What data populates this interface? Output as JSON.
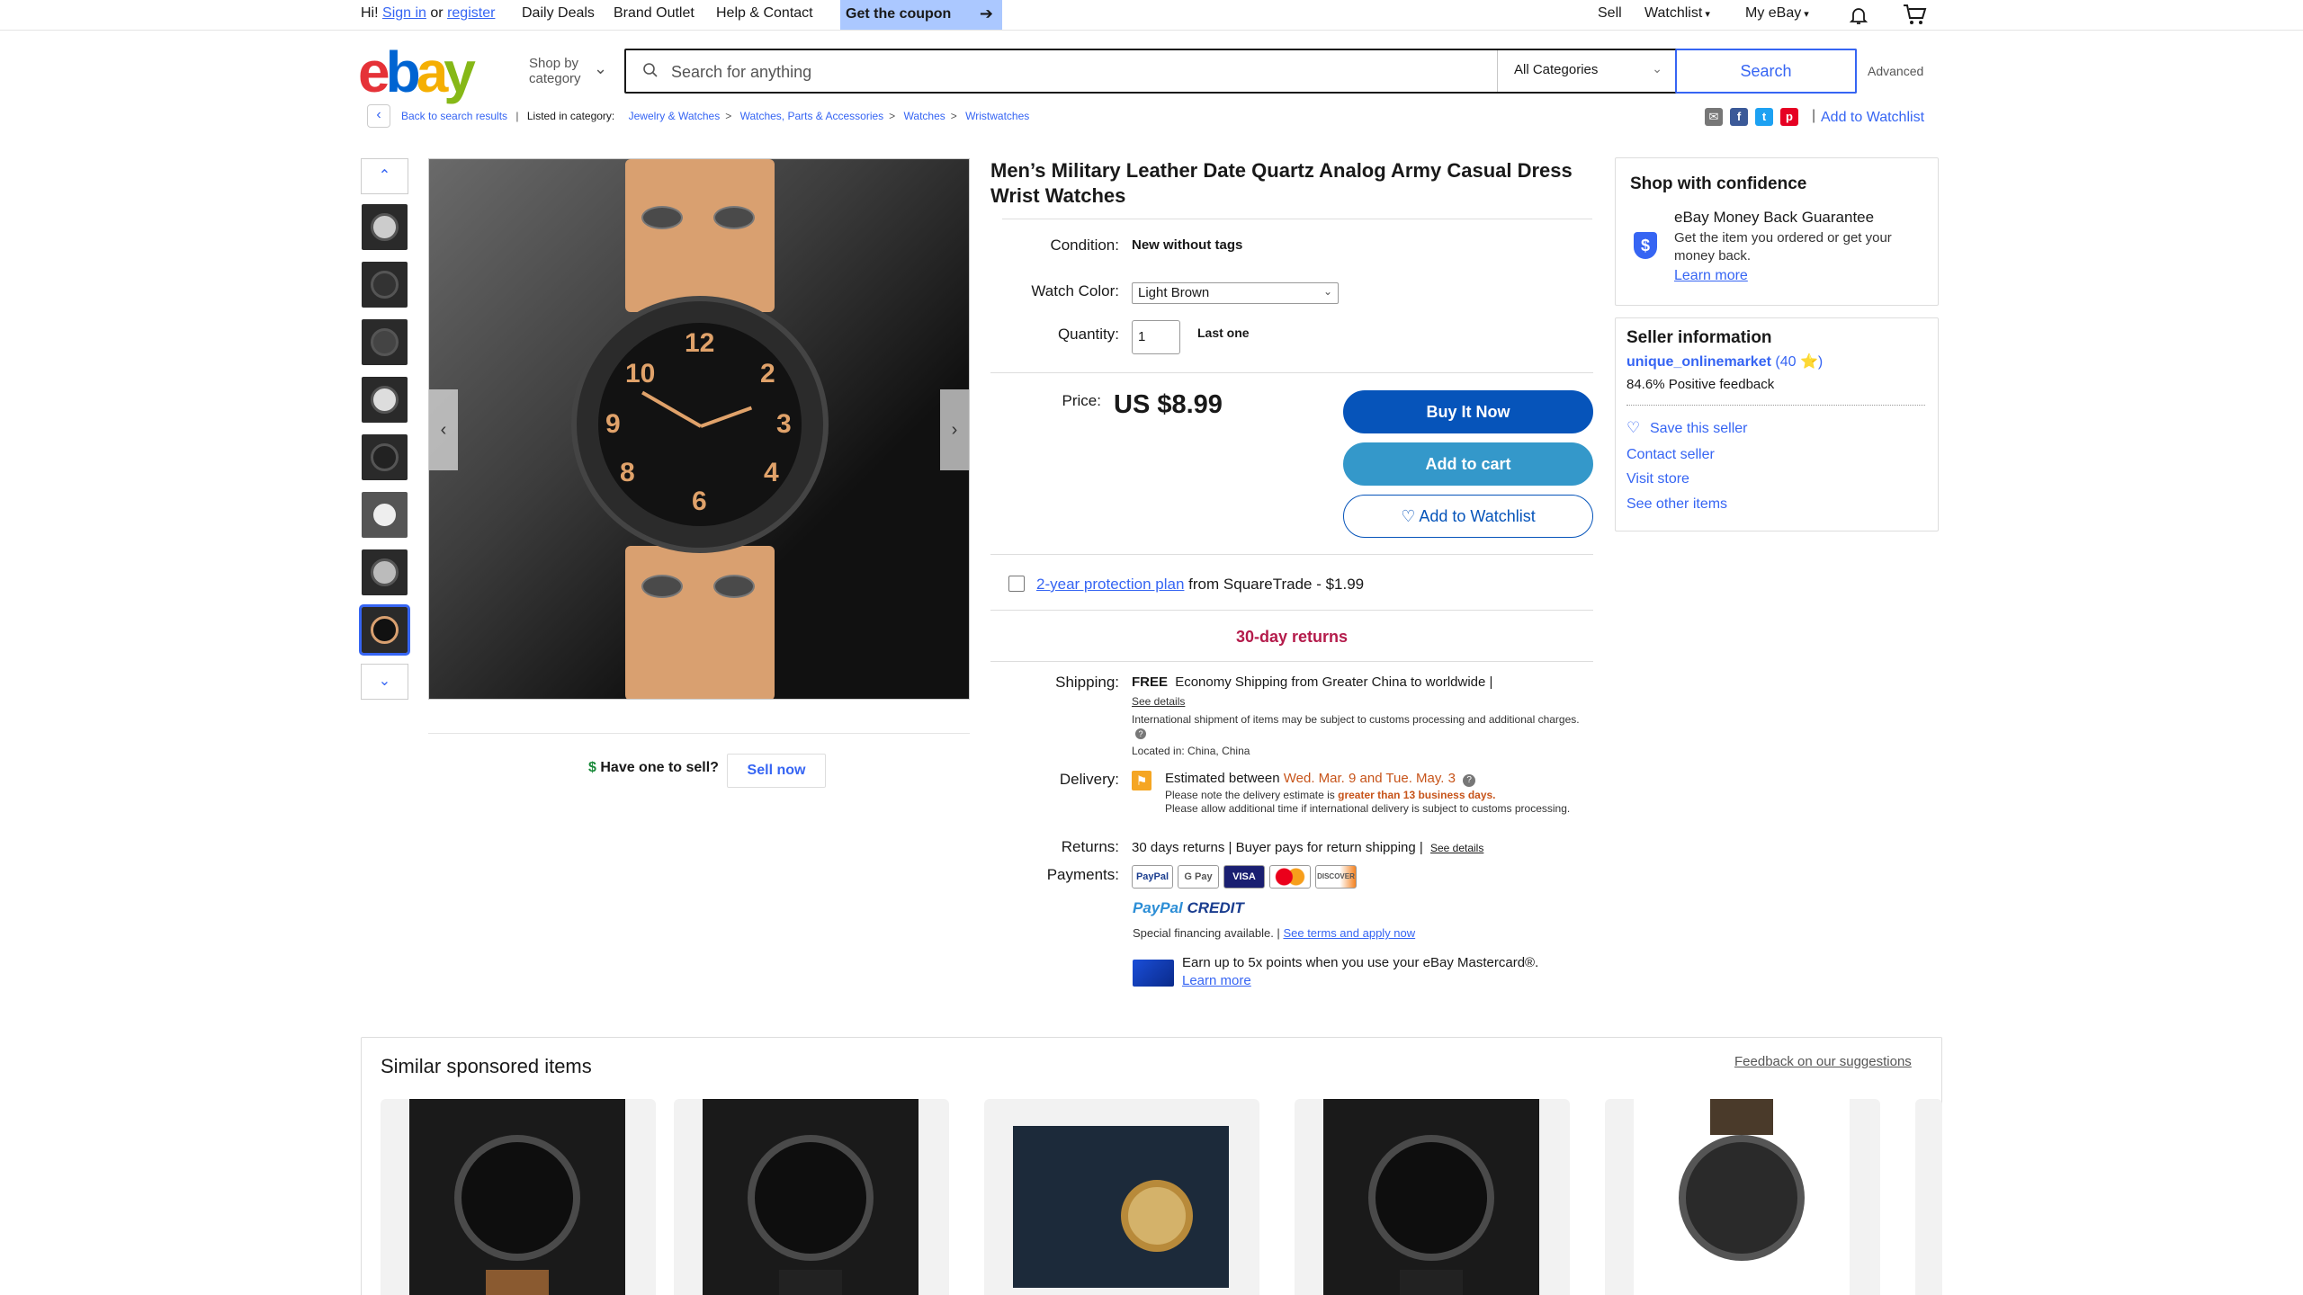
{
  "topnav": {
    "greeting": "Hi!",
    "sign_in": "Sign in",
    "or": "or",
    "register": "register",
    "daily_deals": "Daily Deals",
    "brand_outlet": "Brand Outlet",
    "help_contact": "Help & Contact",
    "coupon": "Get the coupon",
    "sell": "Sell",
    "watchlist": "Watchlist",
    "my_ebay": "My eBay"
  },
  "header": {
    "shop_by_line1": "Shop by",
    "shop_by_line2": "category",
    "search_placeholder": "Search for anything",
    "category": "All Categories",
    "search_button": "Search",
    "advanced": "Advanced"
  },
  "breadcrumb": {
    "back": "Back to search results",
    "listed_in": "Listed in category:",
    "items": [
      "Jewelry & Watches",
      "Watches, Parts & Accessories",
      "Watches",
      "Wristwatches"
    ],
    "add_to_watchlist": "Add to Watchlist"
  },
  "gallery": {
    "sell": {
      "question": "Have one to sell?",
      "button": "Sell now"
    },
    "watch_face_numerals": [
      "12",
      "10",
      "2",
      "9",
      "3",
      "8",
      "4",
      "6"
    ]
  },
  "item": {
    "title": "Men’s Military Leather Date Quartz Analog Army Casual Dress Wrist Watches",
    "condition_label": "Condition:",
    "condition": "New without tags",
    "color_label": "Watch Color:",
    "color": "Light Brown",
    "qty_label": "Quantity:",
    "qty": "1",
    "qty_note": "Last one",
    "price_label": "Price:",
    "price": "US $8.99",
    "buy_now": "Buy It Now",
    "add_to_cart": "Add to cart",
    "add_to_watchlist": "♡ Add to Watchlist",
    "protection_link": "2-year protection plan",
    "protection_rest": "from SquareTrade - $1.99",
    "returns_30": "30-day returns",
    "shipping_label": "Shipping:",
    "shipping_free": "FREE",
    "shipping_text": "Economy Shipping from Greater China to worldwide |",
    "see_details": "See details",
    "intl_note": "International shipment of items may be subject to customs processing and additional charges.",
    "located": "Located in: China, China",
    "delivery_label": "Delivery:",
    "delivery_est": "Estimated between",
    "delivery_dates": "Wed. Mar. 9 and Tue. May. 3",
    "delivery_note_a": "Please note the delivery estimate is",
    "delivery_note_b": "greater than 13 business days.",
    "delivery_note_c": "Please allow additional time if international delivery is subject to customs processing.",
    "returns_label": "Returns:",
    "returns_text": "30 days returns | Buyer pays for return shipping |",
    "returns_details": "See details",
    "payments_label": "Payments:",
    "payment_methods": [
      "PayPal",
      "G Pay",
      "VISA",
      "MC",
      "DISCOVER"
    ],
    "paypal_credit_a": "PayPal",
    "paypal_credit_b": "CREDIT",
    "financing": "Special financing available. |",
    "financing_link": "See terms and apply now",
    "mastercard_text": "Earn up to 5x points when you use your eBay Mastercard®.",
    "learn_more": "Learn more"
  },
  "confidence": {
    "title": "Shop with confidence",
    "guarantee_title": "eBay Money Back Guarantee",
    "guarantee_text": "Get the item you ordered or get your money back.",
    "learn_more": "Learn more"
  },
  "seller": {
    "title": "Seller information",
    "name": "unique_onlinemarket",
    "rating": "(40 ⭐)",
    "feedback": "84.6% Positive feedback",
    "save": "Save this seller",
    "contact": "Contact seller",
    "visit": "Visit store",
    "other": "See other items"
  },
  "similar": {
    "title": "Similar sponsored items",
    "feedback": "Feedback on our suggestions"
  }
}
